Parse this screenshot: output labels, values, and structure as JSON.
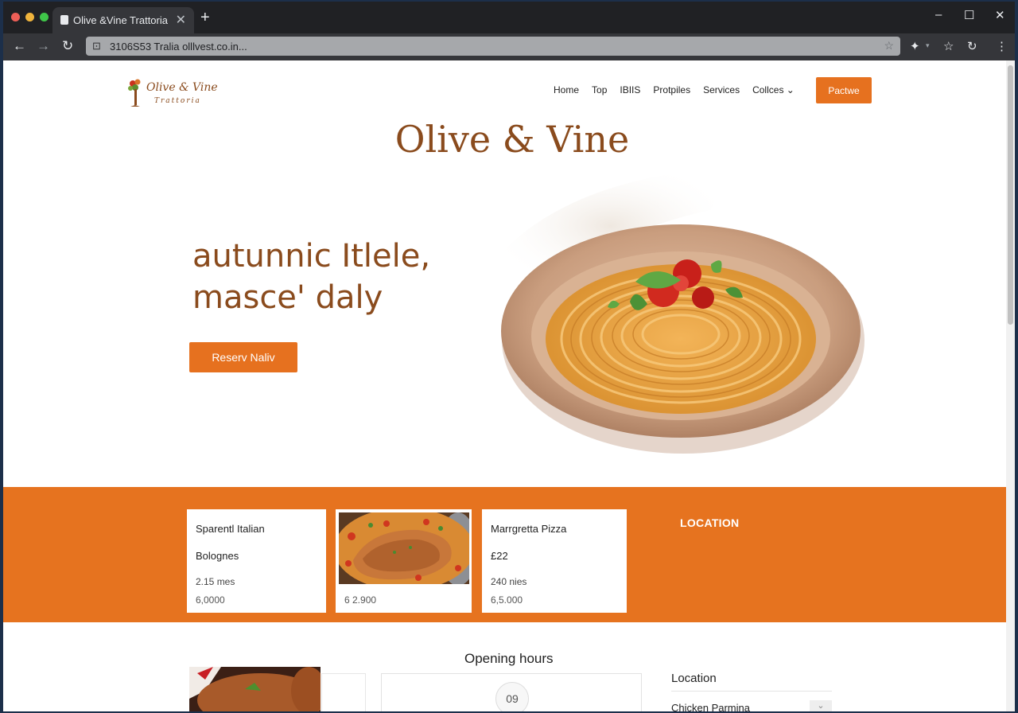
{
  "browser": {
    "tab_title": "Olive &Vine Trattoria",
    "new_tab_icon": "+",
    "close_tab_icon": "✕",
    "url": "3106S53 Tralia olllvest.co.in...",
    "window_controls": [
      "–",
      "☐",
      "✕"
    ]
  },
  "site": {
    "logo_name": "Olive & Vine",
    "logo_sub": "Trattoria",
    "nav": [
      "Home",
      "Top",
      "IBIIS",
      "Protpiles",
      "Services",
      "Collces ⌄"
    ],
    "cta_label": "Pactwe",
    "hero_title": "Olive & Vine",
    "hero_line1": "autunnic Itlele,",
    "hero_line2": "masce' daly",
    "reserve_label": "Reserv Naliv"
  },
  "menu_band": {
    "cards": [
      {
        "line1": "Sparentl Italian",
        "line2": "Bolognes",
        "line3": "2.15 mes",
        "line4": "6,0000"
      },
      {
        "line4": "6 2.900"
      },
      {
        "line1": "Marrgretta Pizza",
        "line2": "£22",
        "line3": "240 nies",
        "line4": "6,5.000"
      }
    ],
    "location_label": "LOCATION"
  },
  "lower": {
    "hours_title": "Opening hours",
    "hours_value": "09",
    "location_title": "Location",
    "location_item": "Chicken Parmina"
  },
  "colors": {
    "accent": "#e6731f",
    "brand_brown": "#8a4b1d"
  }
}
